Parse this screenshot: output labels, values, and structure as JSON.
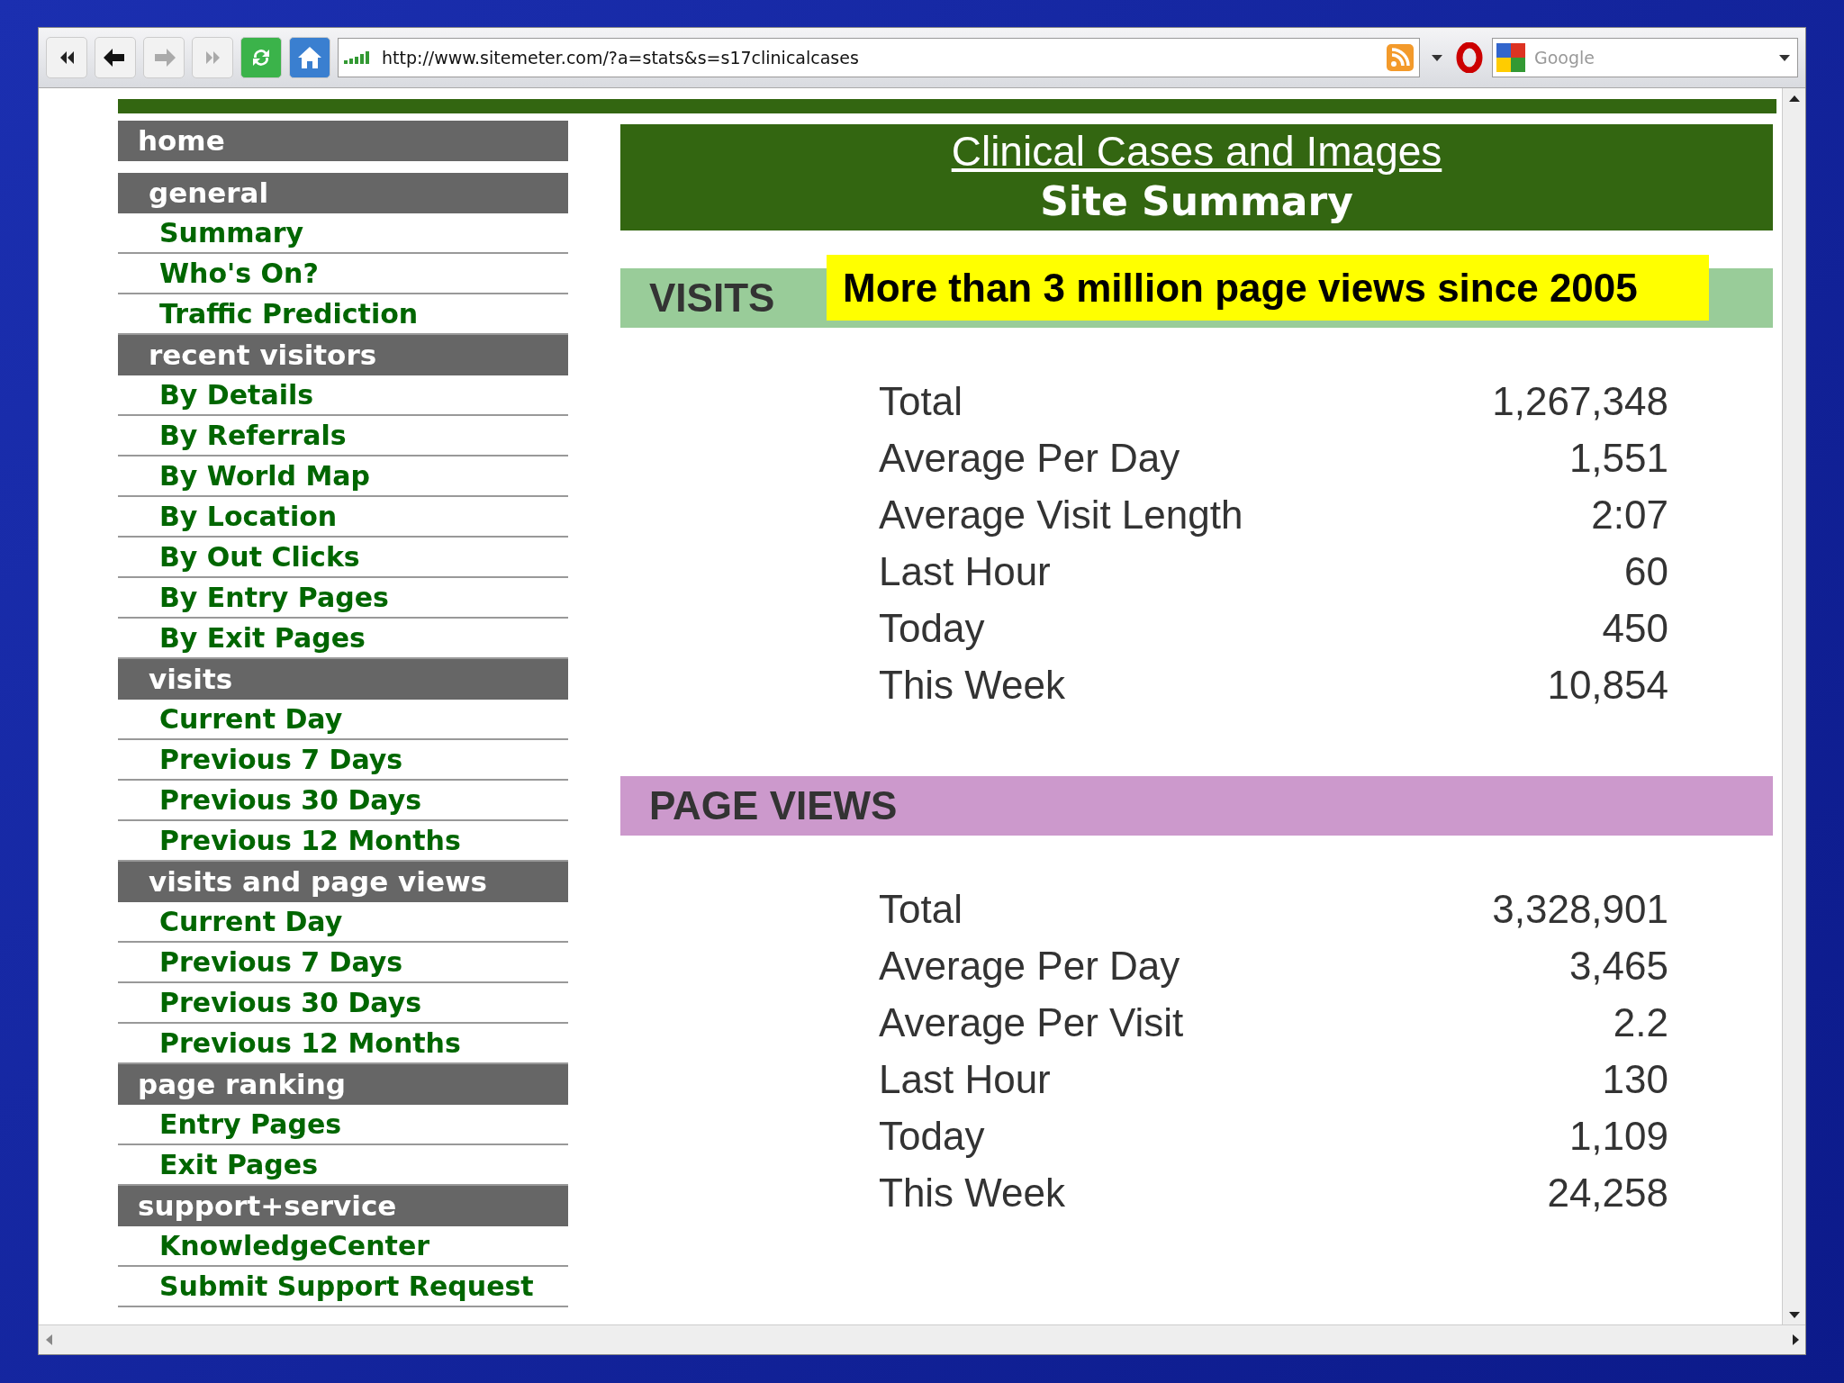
{
  "toolbar": {
    "url": "http://www.sitemeter.com/?a=stats&s=s17clinicalcases",
    "search": {
      "placeholder": "Google"
    }
  },
  "sidebar": [
    {
      "label": "home"
    },
    {
      "label": "general",
      "items": [
        "Summary",
        "Who's On?",
        "Traffic Prediction"
      ]
    },
    {
      "label": "recent visitors",
      "items": [
        "By Details",
        "By Referrals",
        "By World Map",
        "By Location",
        "By Out Clicks",
        "By Entry Pages",
        "By Exit Pages"
      ]
    },
    {
      "label": "visits",
      "items": [
        "Current Day",
        "Previous 7 Days",
        "Previous 30 Days",
        "Previous 12 Months"
      ]
    },
    {
      "label": "visits and page views",
      "items": [
        "Current Day",
        "Previous 7 Days",
        "Previous 30 Days",
        "Previous 12 Months"
      ]
    },
    {
      "label": "page ranking",
      "items": [
        "Entry Pages",
        "Exit Pages"
      ]
    },
    {
      "label": "support+service",
      "items": [
        "KnowledgeCenter",
        "Submit Support Request"
      ]
    }
  ],
  "title": "Clinical Cases and Images",
  "subtitle": "Site Summary",
  "sections": [
    {
      "heading": "VISITS",
      "color": "#99cc99",
      "banner": "More than 3 million page views since 2005",
      "rows": [
        {
          "label": "Total",
          "value": "1,267,348"
        },
        {
          "label": "Average Per Day",
          "value": "1,551"
        },
        {
          "label": "Average Visit Length",
          "value": "2:07"
        },
        {
          "label": "Last Hour",
          "value": "60"
        },
        {
          "label": "Today",
          "value": "450"
        },
        {
          "label": "This Week",
          "value": "10,854"
        }
      ]
    },
    {
      "heading": "PAGE VIEWS",
      "color": "#cc99cc",
      "rows": [
        {
          "label": "Total",
          "value": "3,328,901"
        },
        {
          "label": "Average Per Day",
          "value": "3,465"
        },
        {
          "label": "Average Per Visit",
          "value": "2.2"
        },
        {
          "label": "Last Hour",
          "value": "130"
        },
        {
          "label": "Today",
          "value": "1,109"
        },
        {
          "label": "This Week",
          "value": "24,258"
        }
      ]
    }
  ]
}
